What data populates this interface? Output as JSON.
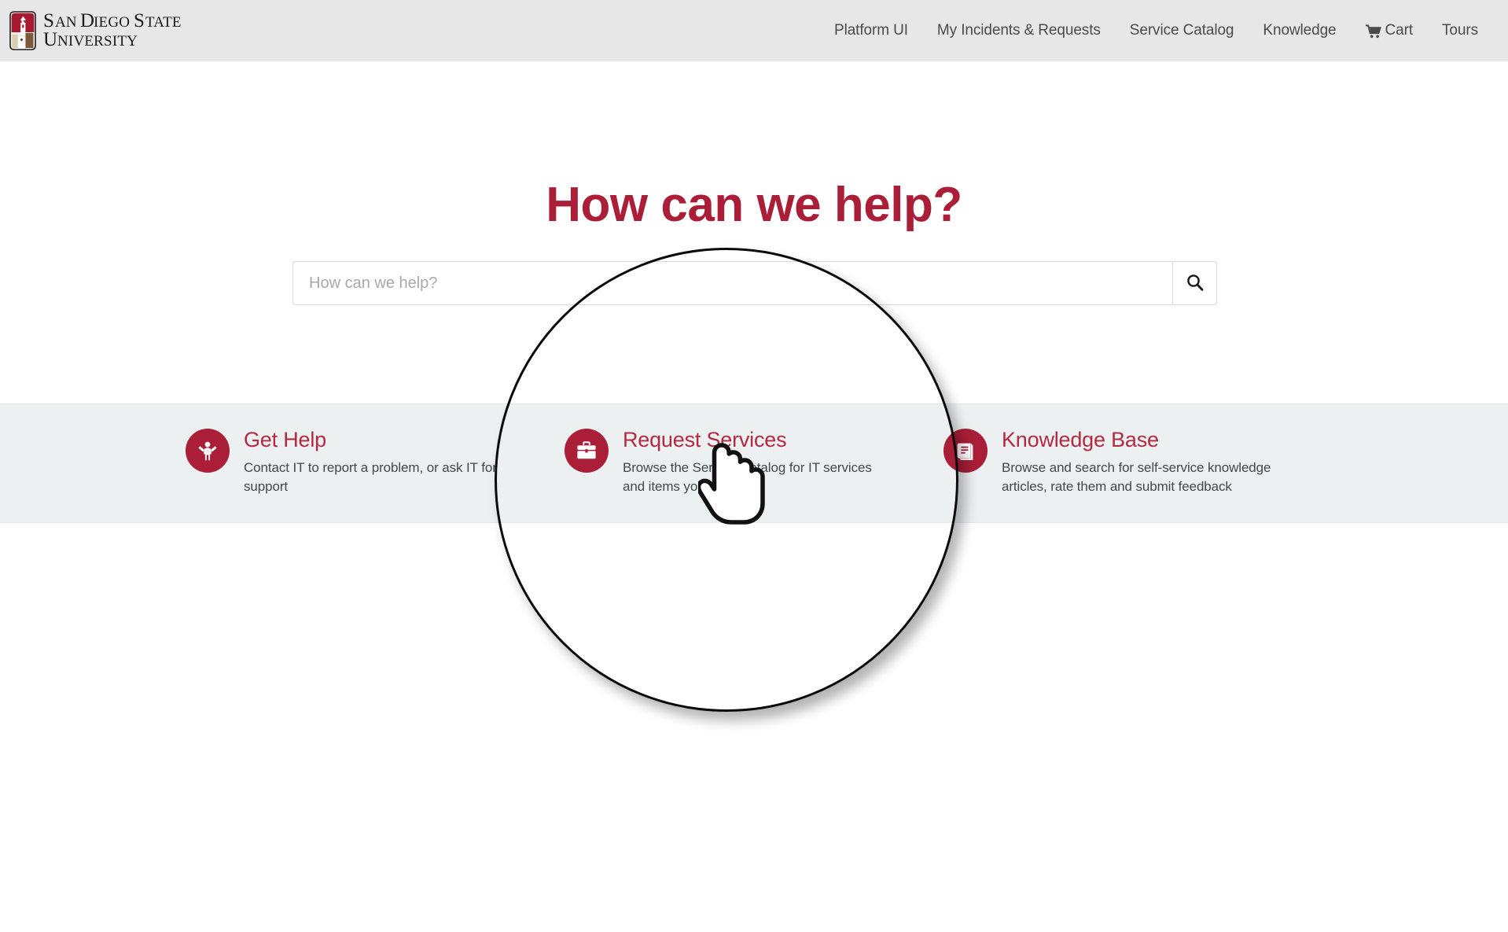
{
  "header": {
    "logo": {
      "icon": "sdsu-crest-icon",
      "line1": "San Diego State",
      "line2": "University"
    },
    "nav": [
      {
        "label": "Platform UI",
        "icon": null
      },
      {
        "label": "My Incidents & Requests",
        "icon": null
      },
      {
        "label": "Service Catalog",
        "icon": null
      },
      {
        "label": "Knowledge",
        "icon": null
      },
      {
        "label": "Cart",
        "icon": "shopping-cart-icon"
      },
      {
        "label": "Tours",
        "icon": null
      }
    ]
  },
  "hero": {
    "title": "How can we help?",
    "search": {
      "value": "",
      "placeholder": "How can we help?",
      "button_icon": "search-icon"
    }
  },
  "cards": [
    {
      "icon": "person-raised-arms-icon",
      "title": "Get Help",
      "description": "Contact IT to report a problem, or ask IT for support"
    },
    {
      "icon": "briefcase-icon",
      "title": "Request Services",
      "description": "Browse the Service Catalog for IT services and items you need"
    },
    {
      "icon": "book-icon",
      "title": "Knowledge Base",
      "description": "Browse and search for self-service knowledge articles, rate them and submit feedback"
    }
  ],
  "overlay": {
    "magnifier": "magnifier-circle-highlight",
    "cursor": "pointing-hand-cursor"
  },
  "colors": {
    "brand_crimson": "#aa1e37",
    "card_title": "#b22a42",
    "header_bg": "#e7e7e7",
    "band_bg": "#edf0f1",
    "body_text": "#44484a",
    "nav_text": "#4b4b4b"
  }
}
